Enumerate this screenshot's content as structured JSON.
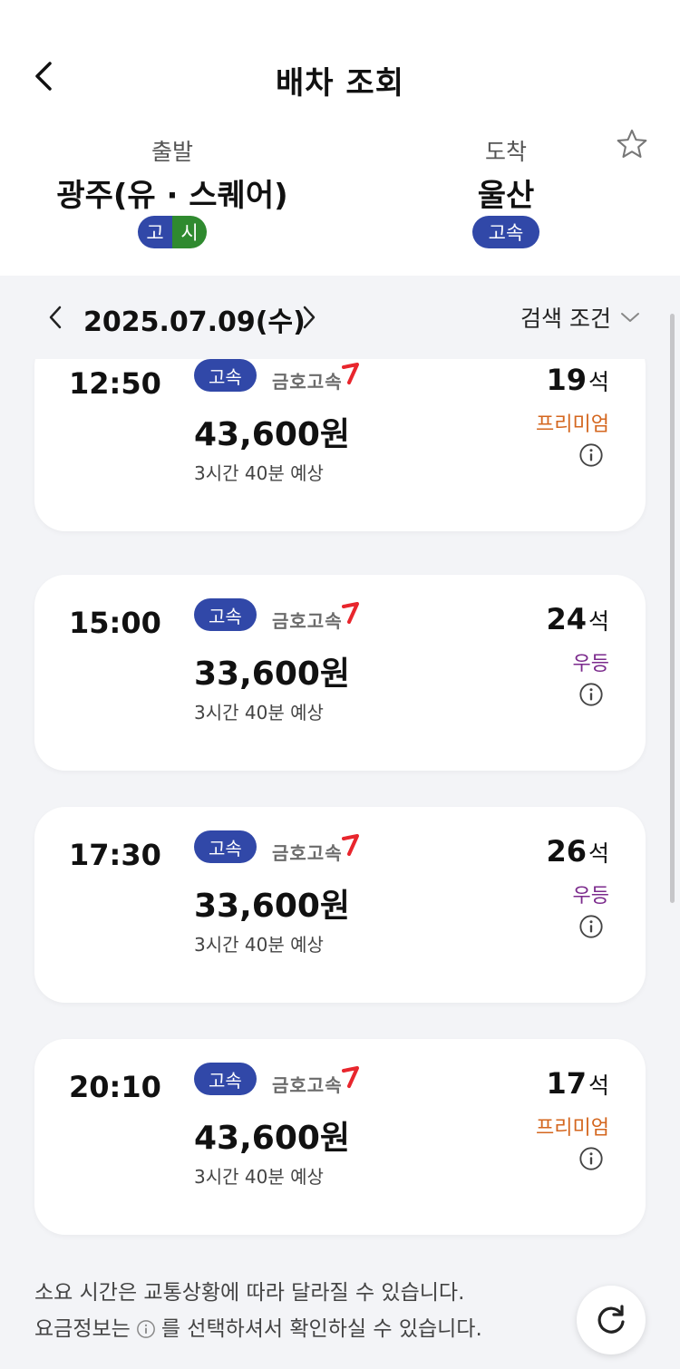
{
  "header": {
    "title": "배차 조회",
    "back_icon": "chevron-left-icon",
    "favorite_icon": "star-outline-icon"
  },
  "route": {
    "departure": {
      "label": "출발",
      "name": "광주(유 · 스퀘어)",
      "badges": [
        "고",
        "시"
      ]
    },
    "arrival": {
      "label": "도착",
      "name": "울산",
      "badges": [
        "고속"
      ]
    }
  },
  "date_bar": {
    "date": "2025.07.09(수)",
    "filter_label": "검색 조건"
  },
  "cards": [
    {
      "time": "12:50",
      "bus_type": "고속",
      "company": "금호고속",
      "price": "43,600원",
      "duration": "3시간 40분 예상",
      "seats": "19",
      "seat_unit": "석",
      "grade": "프리미엄",
      "grade_kind": "premium"
    },
    {
      "time": "15:00",
      "bus_type": "고속",
      "company": "금호고속",
      "price": "33,600원",
      "duration": "3시간 40분 예상",
      "seats": "24",
      "seat_unit": "석",
      "grade": "우등",
      "grade_kind": "excellent"
    },
    {
      "time": "17:30",
      "bus_type": "고속",
      "company": "금호고속",
      "price": "33,600원",
      "duration": "3시간 40분 예상",
      "seats": "26",
      "seat_unit": "석",
      "grade": "우등",
      "grade_kind": "excellent"
    },
    {
      "time": "20:10",
      "bus_type": "고속",
      "company": "금호고속",
      "price": "43,600원",
      "duration": "3시간 40분 예상",
      "seats": "17",
      "seat_unit": "석",
      "grade": "프리미엄",
      "grade_kind": "premium"
    }
  ],
  "footer": {
    "notice_line1": "소요 시간은 교통상황에 따라 달라질 수 있습니다.",
    "notice_line2_prefix": "요금정보는",
    "notice_line2_suffix": "를 선택하셔서 확인하실 수 있습니다."
  },
  "colors": {
    "express_blue": "#3148a8",
    "intercity_green": "#2f8a2f",
    "premium": "#d4661e",
    "excellent": "#7b2a8c",
    "kumho_red": "#e8262d"
  }
}
